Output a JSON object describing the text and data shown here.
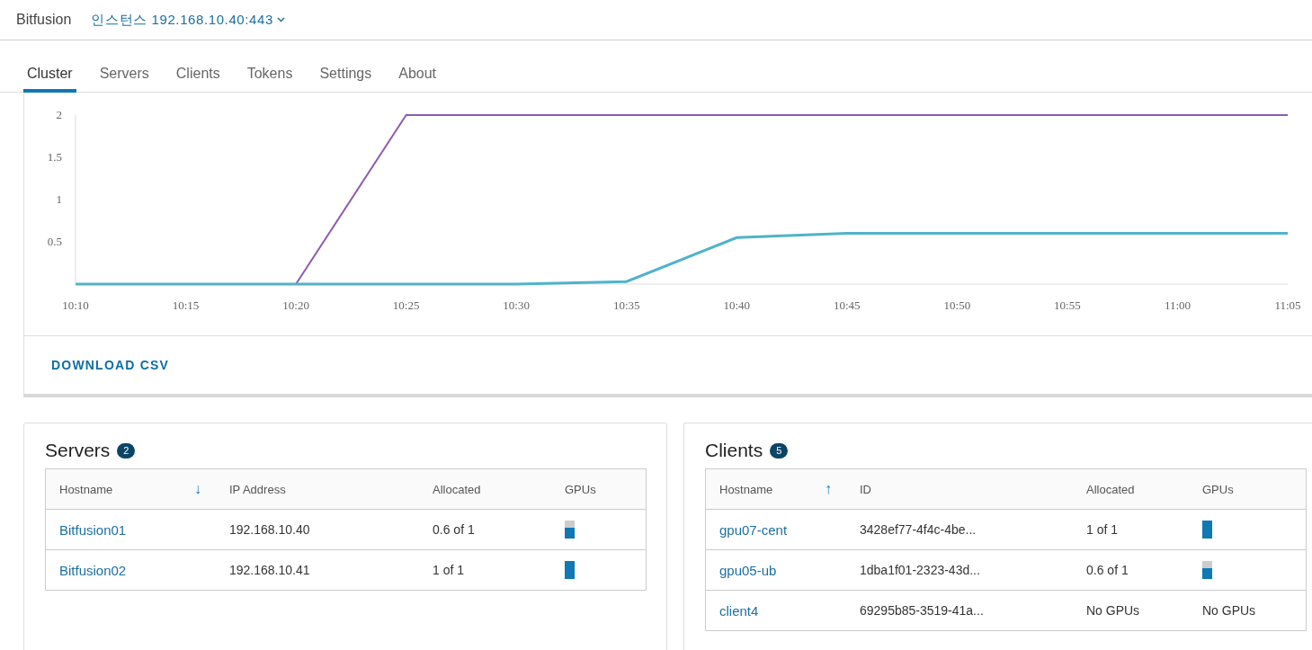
{
  "header": {
    "brand": "Bitfusion",
    "instance": "인스턴스 192.168.10.40:443"
  },
  "tabs": [
    {
      "label": "Cluster",
      "selected": true
    },
    {
      "label": "Servers",
      "selected": false
    },
    {
      "label": "Clients",
      "selected": false
    },
    {
      "label": "Tokens",
      "selected": false
    },
    {
      "label": "Settings",
      "selected": false
    },
    {
      "label": "About",
      "selected": false
    }
  ],
  "cluster_chart": {
    "chart_data": {
      "type": "line",
      "categories": [
        "10:10",
        "10:15",
        "10:20",
        "10:25",
        "10:30",
        "10:35",
        "10:40",
        "10:45",
        "10:50",
        "10:55",
        "11:00",
        "11:05"
      ],
      "series": [
        {
          "color": "#8e5bb0",
          "values": [
            0,
            0,
            0,
            2,
            2,
            2,
            2,
            2,
            2,
            2,
            2,
            2
          ]
        },
        {
          "color": "#4fb3ca",
          "values": [
            0,
            0,
            0,
            0,
            0,
            0.03,
            0.55,
            0.6,
            0.6,
            0.6,
            0.6,
            0.6
          ]
        }
      ],
      "ylim": [
        0,
        2
      ],
      "yticks": [
        0.5,
        1,
        1.5,
        2
      ]
    }
  },
  "download_button": "DOWNLOAD CSV",
  "servers": {
    "title": "Servers",
    "count": "2",
    "columns": [
      {
        "label": "Hostname",
        "sort_arrow": "↓"
      },
      {
        "label": "IP Address"
      },
      {
        "label": "Allocated"
      },
      {
        "label": "GPUs"
      }
    ],
    "rows": [
      {
        "hostname": "Bitfusion01",
        "address": "192.168.10.40",
        "allocated": "0.6 of 1",
        "gpus": {
          "kind": "bar",
          "level": 0.6
        }
      },
      {
        "hostname": "Bitfusion02",
        "address": "192.168.10.41",
        "allocated": "1 of 1",
        "gpus": {
          "kind": "bar",
          "level": 1
        }
      }
    ]
  },
  "clients": {
    "title": "Clients",
    "count": "5",
    "columns": [
      {
        "label": "Hostname",
        "sort_arrow": "↑"
      },
      {
        "label": "ID"
      },
      {
        "label": "Allocated"
      },
      {
        "label": "GPUs"
      }
    ],
    "rows": [
      {
        "hostname": "gpu07-cent",
        "address": "3428ef77-4f4c-4be...",
        "allocated": "1 of 1",
        "gpus": {
          "kind": "bar",
          "level": 1
        }
      },
      {
        "hostname": "gpu05-ub",
        "address": "1dba1f01-2323-43d...",
        "allocated": "0.6 of 1",
        "gpus": {
          "kind": "bar",
          "level": 0.6
        }
      },
      {
        "hostname": "client4",
        "address": "69295b85-3519-41a...",
        "allocated": "No GPUs",
        "gpus": {
          "kind": "text",
          "text": "No GPUs"
        }
      }
    ]
  }
}
